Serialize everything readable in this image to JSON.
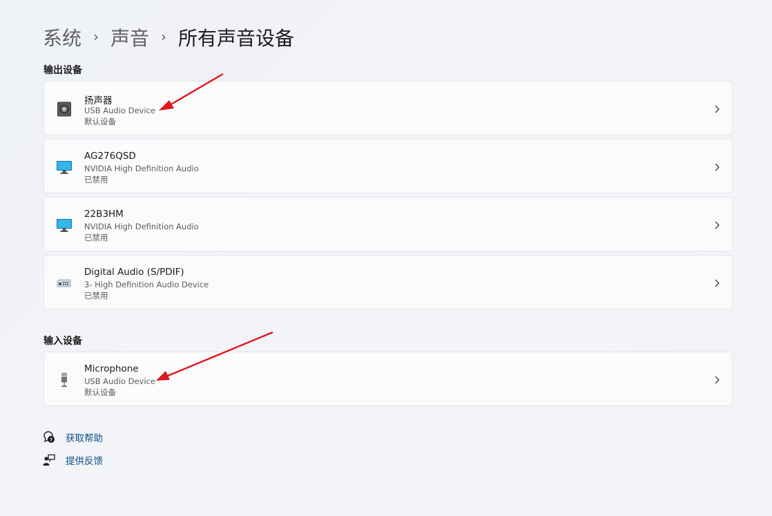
{
  "breadcrumb": {
    "items": [
      "系统",
      "声音"
    ],
    "separator": "›",
    "current": "所有声音设备"
  },
  "output": {
    "title": "输出设备",
    "devices": [
      {
        "name": "扬声器",
        "driver": "USB Audio Device",
        "status": "默认设备",
        "icon": "speaker-icon"
      },
      {
        "name": "AG276QSD",
        "driver": "NVIDIA High Definition Audio",
        "status": "已禁用",
        "icon": "monitor-icon"
      },
      {
        "name": "22B3HM",
        "driver": "NVIDIA High Definition Audio",
        "status": "已禁用",
        "icon": "monitor-icon"
      },
      {
        "name": "Digital Audio (S/PDIF)",
        "driver": "3- High Definition Audio Device",
        "status": "已禁用",
        "icon": "digital-audio-icon"
      }
    ]
  },
  "input": {
    "title": "输入设备",
    "devices": [
      {
        "name": "Microphone",
        "driver": "USB Audio Device",
        "status": "默认设备",
        "icon": "microphone-icon"
      }
    ]
  },
  "links": {
    "help": "获取帮助",
    "feedback": "提供反馈"
  },
  "colors": {
    "link": "#0b4f8a",
    "annotation_arrow": "#e0161c",
    "card_bg": "#fbfbfc"
  }
}
